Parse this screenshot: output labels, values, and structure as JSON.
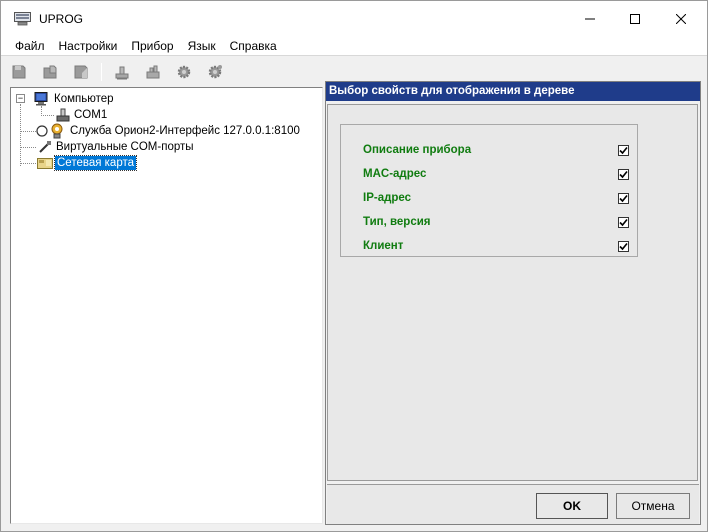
{
  "window": {
    "title": "UPROG",
    "controls": [
      "minimize",
      "maximize",
      "close"
    ]
  },
  "menu": {
    "items": [
      {
        "label": "Файл"
      },
      {
        "label": "Настройки"
      },
      {
        "label": "Прибор"
      },
      {
        "label": "Язык"
      },
      {
        "label": "Справка"
      }
    ]
  },
  "toolbar": {
    "buttons": [
      {
        "icon": "floppy-icon"
      },
      {
        "icon": "open-folder-icon"
      },
      {
        "icon": "save-as-icon"
      },
      {
        "icon": "read-device-icon"
      },
      {
        "icon": "write-device-icon"
      },
      {
        "icon": "gear-icon"
      },
      {
        "icon": "gear-settings-icon"
      }
    ]
  },
  "tree": {
    "nodes": [
      {
        "label": "Компьютер",
        "icon": "computer-icon",
        "expanded": true
      },
      {
        "label": "COM1",
        "icon": "com-port-icon"
      },
      {
        "label": "Служба Орион2-Интерфейс 127.0.0.1:8100",
        "icon": "service-icon"
      },
      {
        "label": "Виртуальные COM-порты",
        "icon": "virtual-port-icon"
      },
      {
        "label": "Сетевая карта",
        "icon": "network-card-icon",
        "selected": true
      }
    ]
  },
  "properties": {
    "header": "Выбор свойств для отображения в дереве",
    "items": [
      {
        "label": "Описание прибора",
        "checked": true
      },
      {
        "label": "MAC-адрес",
        "checked": true
      },
      {
        "label": "IP-адрес",
        "checked": true
      },
      {
        "label": "Тип, версия",
        "checked": true
      },
      {
        "label": "Клиент",
        "checked": true
      }
    ],
    "ok_label": "OK",
    "cancel_label": "Отмена"
  },
  "colors": {
    "header_bg": "#1f3c8a",
    "prop_label": "#107c10",
    "selection": "#0078d7"
  }
}
